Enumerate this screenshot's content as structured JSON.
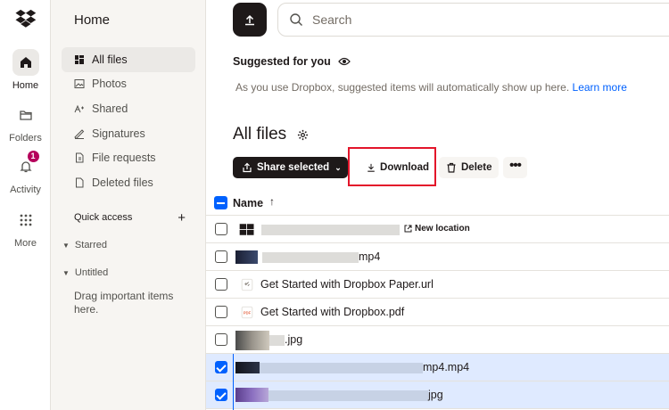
{
  "rail": {
    "items": [
      {
        "label": "Home",
        "icon": "home-icon",
        "active": true
      },
      {
        "label": "Folders",
        "icon": "folder-icon"
      },
      {
        "label": "Activity",
        "icon": "bell-icon",
        "badge": "1"
      },
      {
        "label": "More",
        "icon": "grid-icon"
      }
    ]
  },
  "sidebar": {
    "title": "Home",
    "items": [
      {
        "label": "All files",
        "icon": "all-files-icon"
      },
      {
        "label": "Photos",
        "icon": "photo-icon"
      },
      {
        "label": "Shared",
        "icon": "shared-icon"
      },
      {
        "label": "Signatures",
        "icon": "signature-icon"
      },
      {
        "label": "File requests",
        "icon": "file-request-icon"
      },
      {
        "label": "Deleted files",
        "icon": "trash-icon"
      }
    ],
    "quick_access": "Quick access",
    "starred": "Starred",
    "untitled": "Untitled",
    "hint": "Drag important items here."
  },
  "search": {
    "placeholder": "Search"
  },
  "suggested": {
    "title": "Suggested for you",
    "text": "As you use Dropbox, suggested items will automatically show up here.",
    "link": "Learn more"
  },
  "page_title": "All files",
  "toolbar": {
    "share": "Share selected",
    "download": "Download",
    "delete": "Delete"
  },
  "table": {
    "header": "Name",
    "rows": [
      {
        "name_suffix": "",
        "extra": "New location",
        "checked": false
      },
      {
        "name_suffix": "mp4",
        "checked": false
      },
      {
        "name": "Get Started with Dropbox Paper.url",
        "checked": false
      },
      {
        "name": "Get Started with Dropbox.pdf",
        "checked": false
      },
      {
        "name_suffix": ".jpg",
        "checked": false
      },
      {
        "name_suffix": "mp4.mp4",
        "checked": true
      },
      {
        "name_suffix": "jpg",
        "checked": true
      }
    ]
  },
  "colors": {
    "accent": "#0061fe",
    "selected_row": "#dfeaff",
    "highlight": "#e3152a",
    "dark": "#1e1919"
  }
}
